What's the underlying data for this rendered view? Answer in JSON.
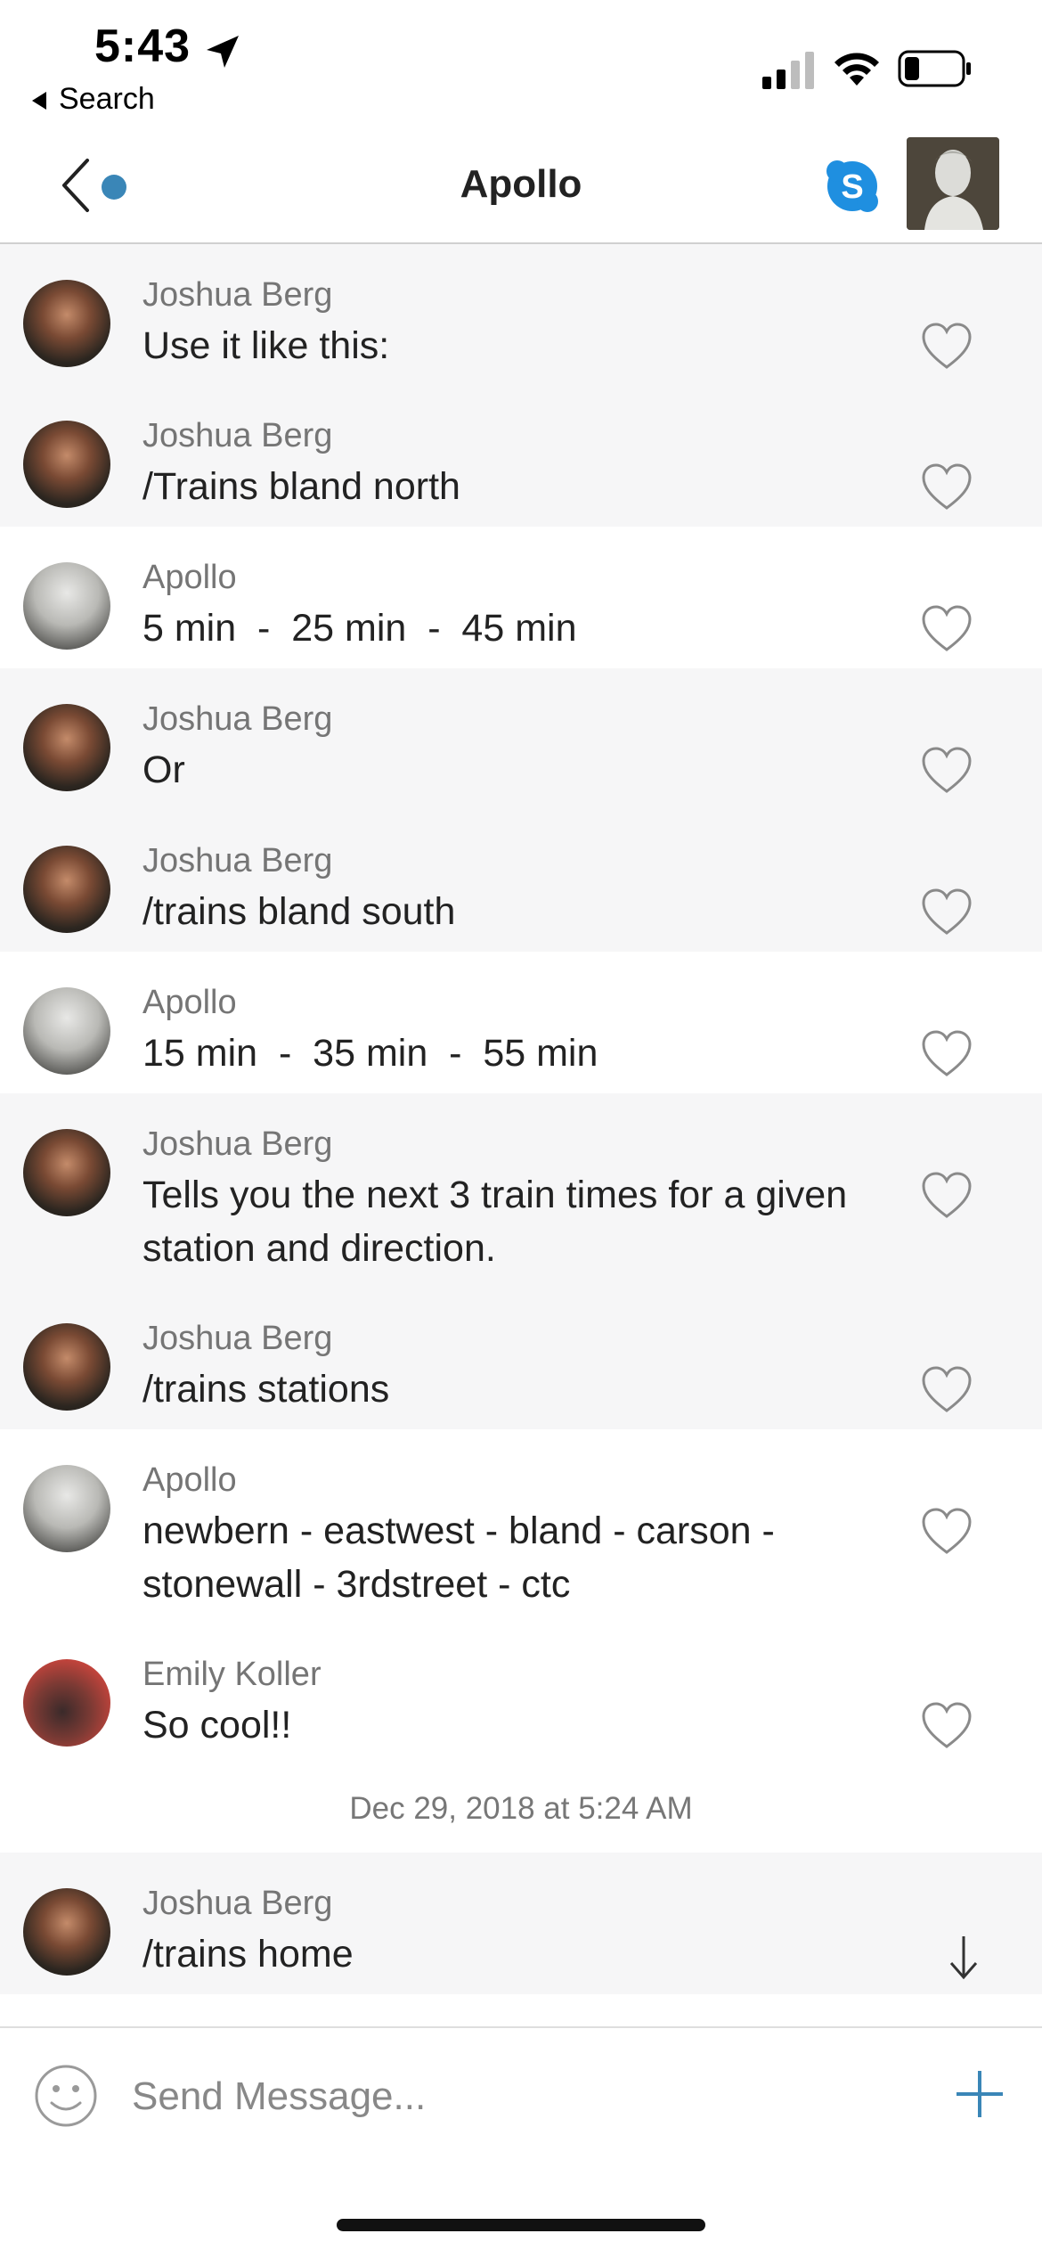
{
  "status_bar": {
    "time": "5:43",
    "back_label": "Search"
  },
  "header": {
    "title": "Apollo",
    "accent_color": "#3a86b7"
  },
  "messages": [
    {
      "author": "Joshua Berg",
      "text": "Use it like this:"
    },
    {
      "author": "Joshua Berg",
      "text": "/Trains bland north"
    },
    {
      "author": "Apollo",
      "text": "5 min  -  25 min  -  45 min"
    },
    {
      "author": "Joshua Berg",
      "text": "Or"
    },
    {
      "author": "Joshua Berg",
      "text": "/trains bland south"
    },
    {
      "author": "Apollo",
      "text": "15 min  -  35 min  -  55 min"
    },
    {
      "author": "Joshua Berg",
      "text": "Tells you the next 3 train times for a given station and direction."
    },
    {
      "author": "Joshua Berg",
      "text": "/trains stations"
    },
    {
      "author": "Apollo",
      "text": "newbern - eastwest - bland - carson - stonewall - 3rdstreet - ctc"
    },
    {
      "author": "Emily Koller",
      "text": "So cool!!"
    },
    {
      "author": "Joshua Berg",
      "text": "/trains home"
    }
  ],
  "timestamp": "Dec 29, 2018 at 5:24 AM",
  "composer": {
    "placeholder": "Send Message..."
  }
}
